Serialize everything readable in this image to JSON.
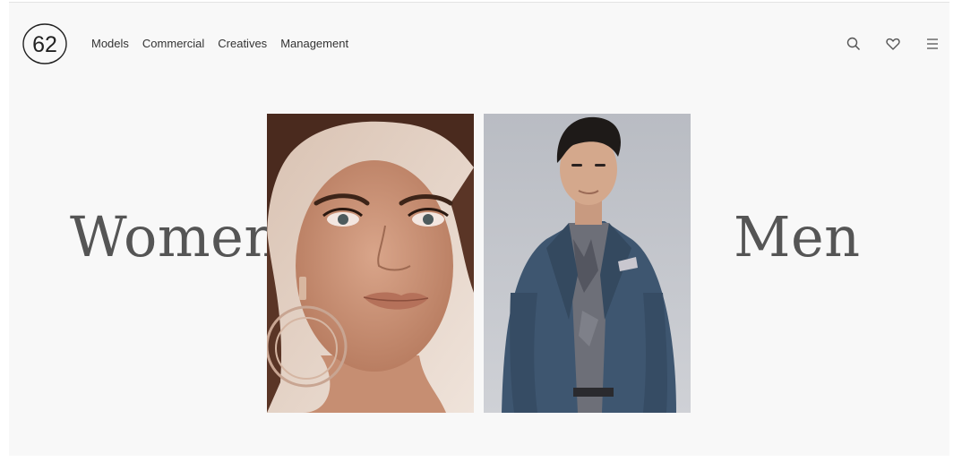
{
  "brand": {
    "logo_text": "62"
  },
  "nav": {
    "items": [
      "Models",
      "Commercial",
      "Creatives",
      "Management"
    ]
  },
  "header_icons": [
    "search-icon",
    "heart-icon",
    "menu-icon"
  ],
  "hero": {
    "left_label": "Women",
    "right_label": "Men"
  },
  "colors": {
    "page_bg": "#f8f8f8",
    "text": "#333333",
    "hero_text": "#555555"
  }
}
